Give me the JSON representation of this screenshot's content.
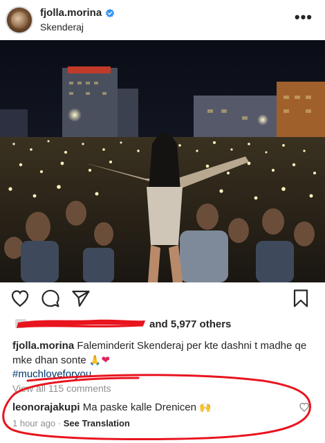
{
  "post": {
    "username": "fjolla.morina",
    "location": "Skenderaj",
    "more_glyph": "•••",
    "likes_suffix": "and 5,977 others",
    "caption_username": "fjolla.morina",
    "caption_text": "Faleminderit Skenderaj per kte dashni t madhe qe mke dhan sonte",
    "caption_emoji_1": "🙏",
    "caption_emoji_2": "❤",
    "hashtag": "#muchloveforyou",
    "view_all": "View all 115 comments"
  },
  "comment": {
    "username": "leonorajakupi",
    "text": "Ma paske kalle Drenicen",
    "emoji": "🙌",
    "time": "1 hour ago",
    "separator": "·",
    "see_translation": "See Translation"
  },
  "icons": {
    "verified": "verified-badge-icon",
    "like": "heart-outline-icon",
    "comment": "comment-bubble-icon",
    "share": "paper-plane-icon",
    "save": "bookmark-icon",
    "comment_like": "small-heart-icon"
  },
  "colors": {
    "verified": "#3897f0",
    "annotation": "#e8141e",
    "hashtag": "#003569",
    "muted": "#8e8e8e"
  }
}
